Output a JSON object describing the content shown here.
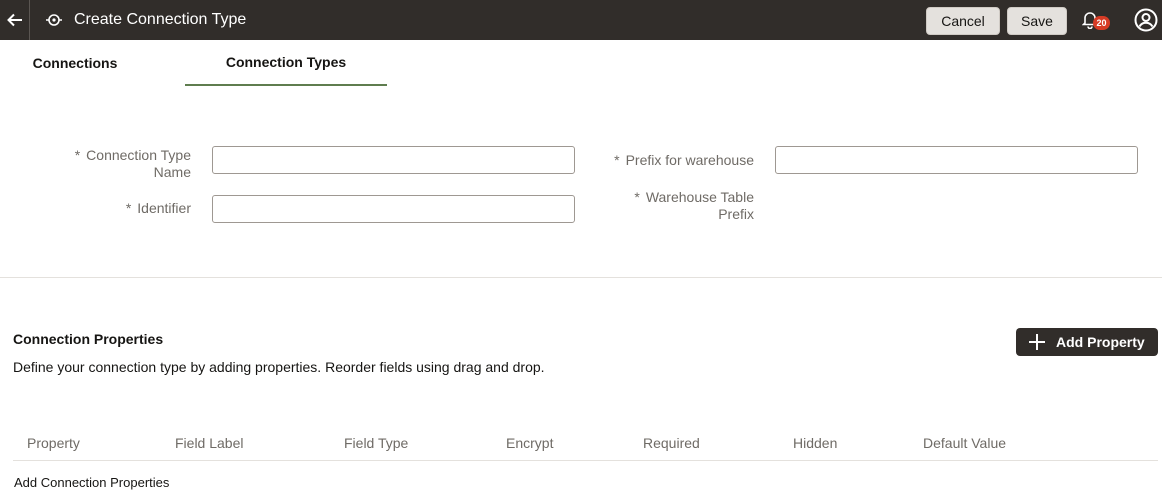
{
  "header": {
    "back_icon": "arrow-left-icon",
    "title_icon": "connection-type-icon",
    "title": "Create Connection Type",
    "cancel_label": "Cancel",
    "save_label": "Save",
    "notifications_icon": "bell-icon",
    "notifications_count": "20",
    "user_icon": "user-avatar-icon"
  },
  "tabs": [
    {
      "label": "Connections",
      "active": false
    },
    {
      "label": "Connection Types",
      "active": true
    }
  ],
  "form": {
    "name_required": "*",
    "name_label": "Connection Type Name",
    "name_value": "",
    "identifier_required": "*",
    "identifier_label": "Identifier",
    "identifier_value": "",
    "prefix_required": "*",
    "prefix_label": "Prefix for warehouse",
    "prefix_value": "",
    "table_prefix_required": "*",
    "table_prefix_label": "Warehouse Table Prefix"
  },
  "properties": {
    "title": "Connection Properties",
    "description": "Define your connection type by adding properties. Reorder fields using drag and drop.",
    "add_button_label": "Add Property",
    "add_icon": "plus-icon",
    "columns": [
      "Property",
      "Field Label",
      "Field Type",
      "Encrypt",
      "Required",
      "Hidden",
      "Default Value"
    ],
    "empty_message": "Add Connection Properties"
  },
  "colors": {
    "header_bg": "#312d2a",
    "active_tab_underline": "#5f7d4f",
    "badge": "#d63b25"
  }
}
